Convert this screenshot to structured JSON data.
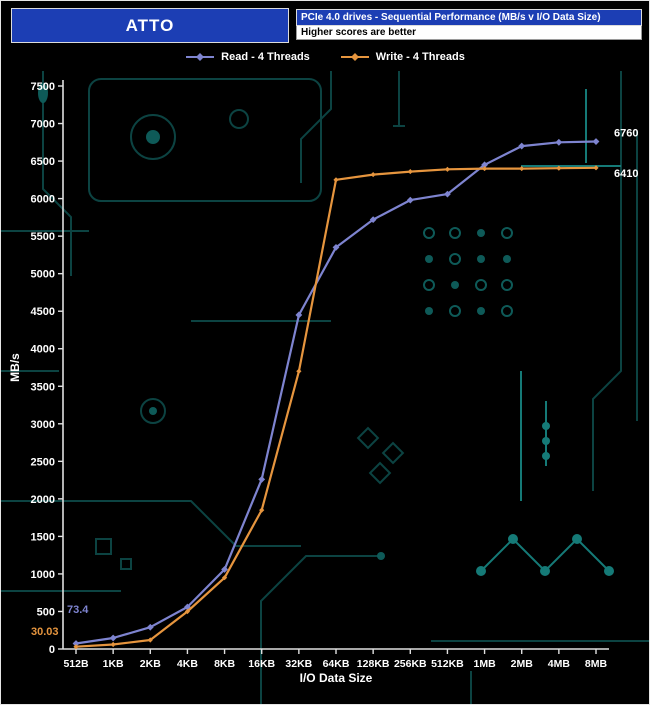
{
  "header": {
    "app_name": "ATTO",
    "title": "PCIe 4.0 drives - Sequential Performance (MB/s v I/O Data Size)",
    "subtitle": "Higher scores are better"
  },
  "colors": {
    "read_series": "#7e84d0",
    "write_series": "#e6953e",
    "header_blue": "#1c3eb4",
    "axis_white": "#e0e0e0",
    "circuit_teal_dim": "#0c4342",
    "circuit_teal_bright": "#157a77"
  },
  "chart_data": {
    "type": "line",
    "title": "PCIe 4.0 drives - Sequential Performance (MB/s v I/O Data Size)",
    "subtitle": "Higher scores are better",
    "xlabel": "I/O Data Size",
    "ylabel": "MB/s",
    "ylim": [
      0,
      7500
    ],
    "ytick_step": 500,
    "grid": false,
    "legend_position": "top",
    "categories": [
      "512B",
      "1KB",
      "2KB",
      "4KB",
      "8KB",
      "16KB",
      "32KB",
      "64KB",
      "128KB",
      "256KB",
      "512KB",
      "1MB",
      "2MB",
      "4MB",
      "8MB"
    ],
    "series": [
      {
        "name": "Read - 4 Threads",
        "color": "#7e84d0",
        "values": [
          73.4,
          147,
          290,
          560,
          1060,
          2260,
          4450,
          5350,
          5720,
          5980,
          6060,
          6450,
          6700,
          6750,
          6760
        ],
        "start_label": "73.4",
        "end_label": "6760"
      },
      {
        "name": "Write - 4 Threads",
        "color": "#e6953e",
        "values": [
          30.03,
          60,
          120,
          500,
          950,
          1850,
          3700,
          6250,
          6320,
          6360,
          6390,
          6400,
          6400,
          6405,
          6410
        ],
        "start_label": "30.03",
        "end_label": "6410"
      }
    ]
  }
}
